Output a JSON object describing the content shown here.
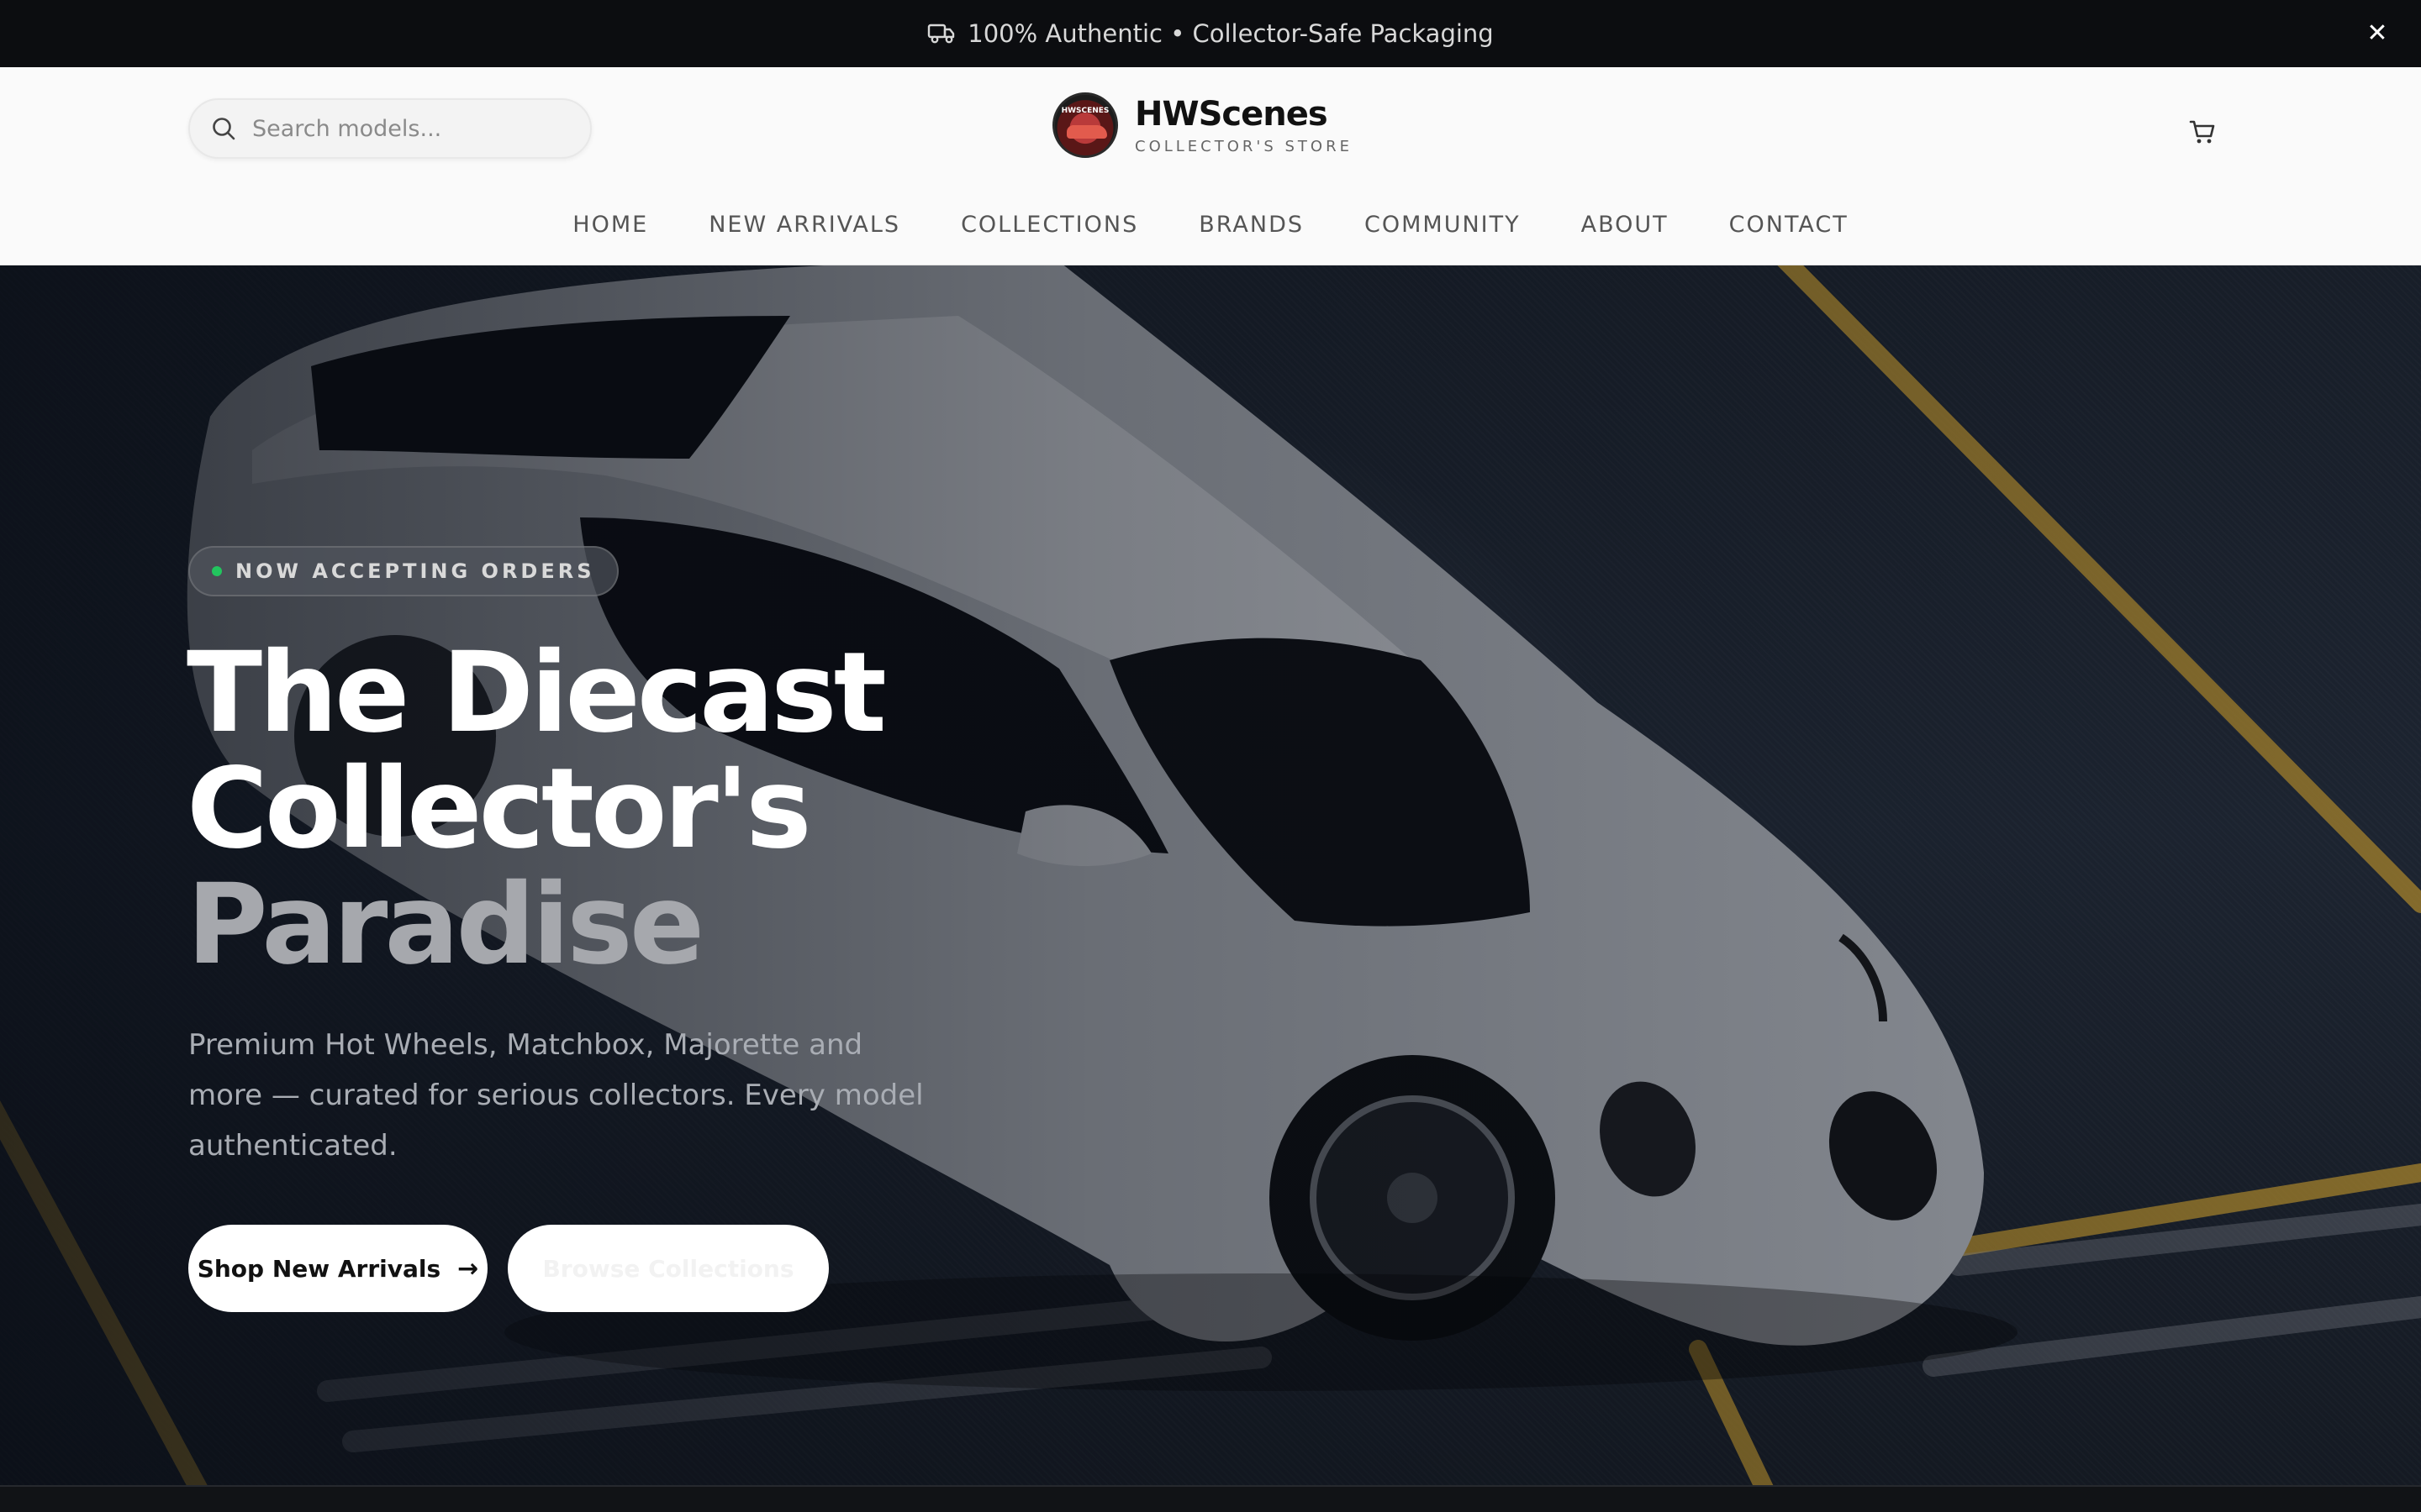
{
  "announcement": {
    "icon": "truck-icon",
    "text": "100% Authentic • Collector-Safe Packaging",
    "close_icon": "close-icon"
  },
  "header": {
    "search": {
      "placeholder": "Search models...",
      "value": "",
      "icon": "search-icon"
    },
    "brand": {
      "name": "HWScenes",
      "tagline": "COLLECTOR'S STORE",
      "logo_icon": "brand-logo",
      "logo_text": "HWSCENES"
    },
    "cart_icon": "cart-icon"
  },
  "nav": {
    "items": [
      {
        "label": "HOME"
      },
      {
        "label": "NEW ARRIVALS"
      },
      {
        "label": "COLLECTIONS"
      },
      {
        "label": "BRANDS"
      },
      {
        "label": "COMMUNITY"
      },
      {
        "label": "ABOUT"
      },
      {
        "label": "CONTACT"
      }
    ]
  },
  "hero": {
    "badge": "NOW ACCEPTING ORDERS",
    "badge_dot_color": "#22c55e",
    "headline": {
      "line1": "The Diecast",
      "line2": "Collector's",
      "line3": "Paradise"
    },
    "subcopy": "Premium Hot Wheels, Matchbox, Majorette and more — curated for serious collectors. Every model authenticated.",
    "primary_button": "Shop New Arrivals",
    "primary_button_icon": "arrow-right-icon",
    "secondary_button": "Browse Collections"
  },
  "colors": {
    "announcement_bg": "#0c0d10",
    "header_bg": "#fafafa",
    "hero_bg": "#1a212c",
    "accent_road_lines": "#c99a2e",
    "badge_dot": "#22c55e"
  }
}
